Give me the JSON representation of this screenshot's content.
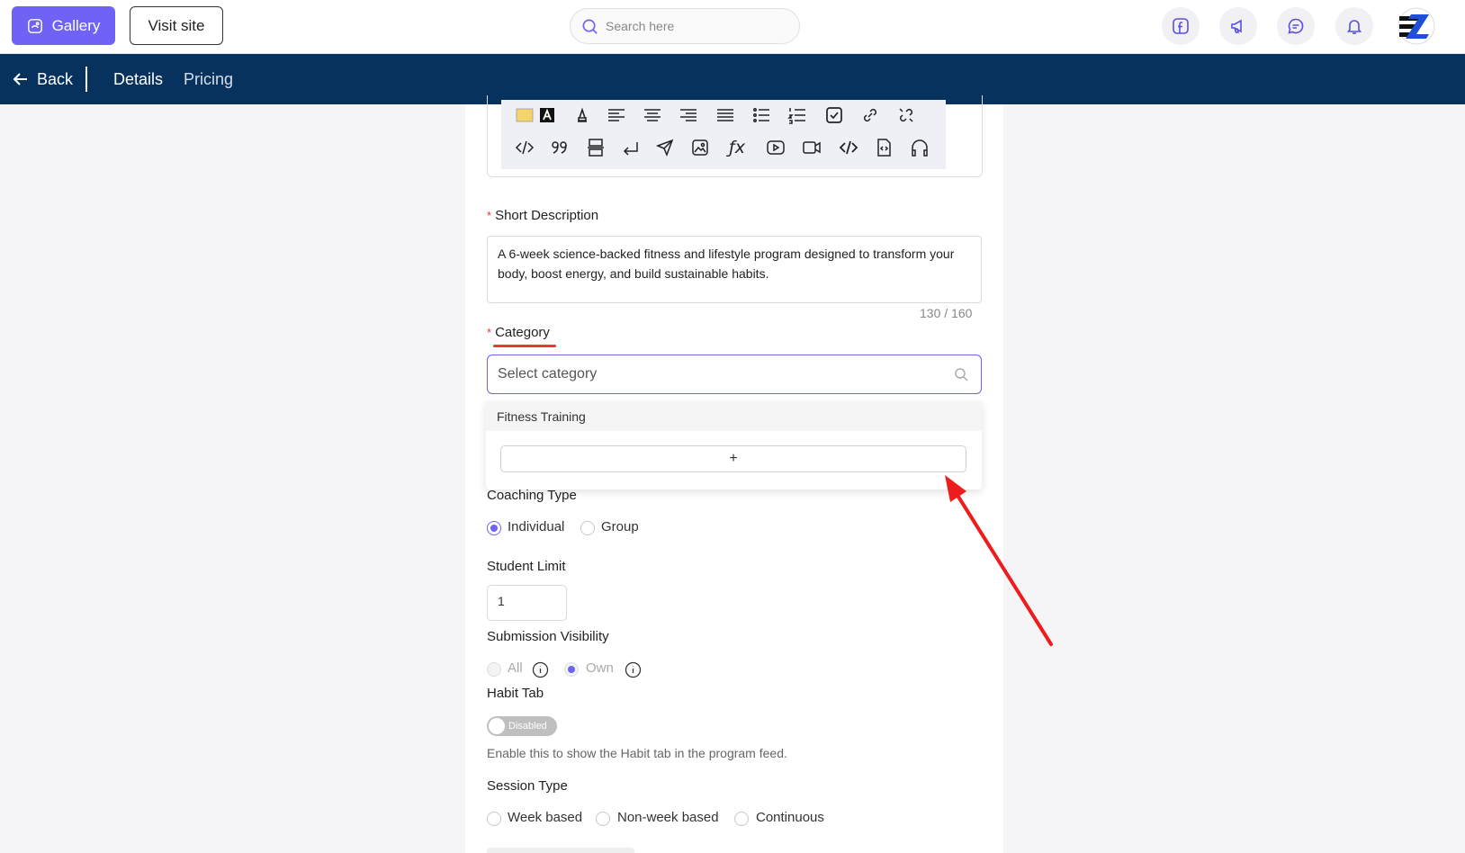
{
  "header": {
    "gallery_label": "Gallery",
    "visit_site_label": "Visit site",
    "search_placeholder": "Search here"
  },
  "nav": {
    "back_label": "Back",
    "tabs": [
      "Details",
      "Pricing"
    ]
  },
  "form": {
    "short_description": {
      "label": "Short Description",
      "value": "A 6-week science-backed fitness and lifestyle program designed to transform your body, boost energy, and build sustainable habits.",
      "counter": "130 / 160"
    },
    "category": {
      "label": "Category",
      "placeholder": "Select category",
      "options": [
        "Fitness Training"
      ],
      "add_button": "+"
    },
    "coaching_type": {
      "label": "Coaching Type",
      "options": [
        "Individual",
        "Group"
      ],
      "selected": "Individual"
    },
    "student_limit": {
      "label": "Student Limit",
      "value": "1"
    },
    "submission_visibility": {
      "label": "Submission Visibility",
      "options": [
        "All",
        "Own"
      ],
      "selected": "Own"
    },
    "habit_tab": {
      "label": "Habit Tab",
      "toggle_text": "Disabled",
      "help": "Enable this to show the Habit tab in the program feed."
    },
    "session_type": {
      "label": "Session Type",
      "options": [
        "Week based",
        "Non-week based",
        "Continuous"
      ]
    }
  },
  "colors": {
    "accent": "#6e63f5",
    "navbar": "#08325e",
    "annotation": "#e53935"
  }
}
